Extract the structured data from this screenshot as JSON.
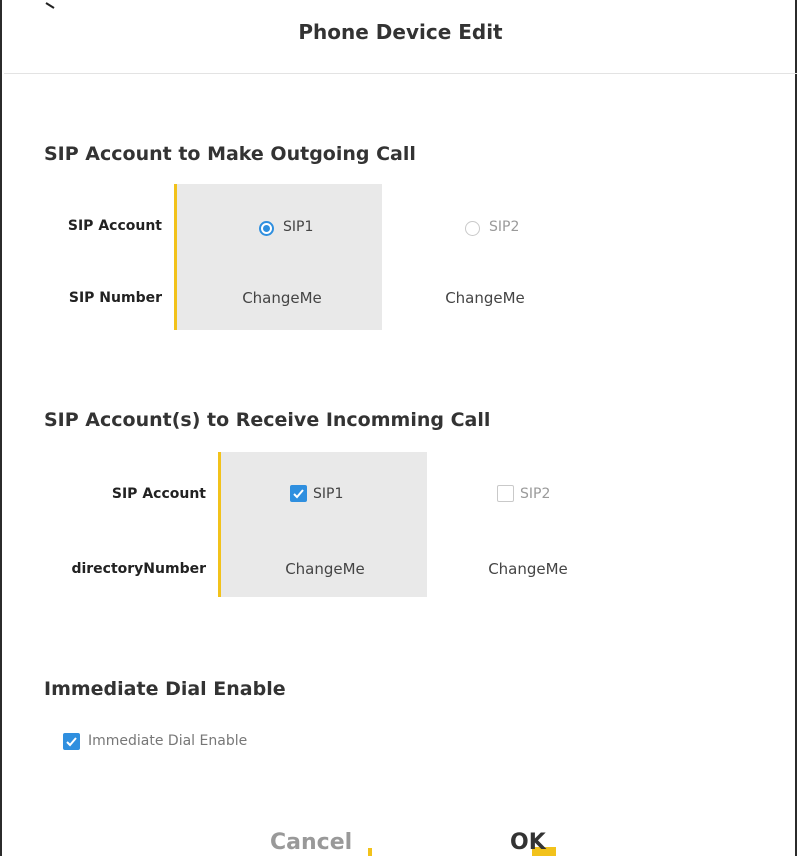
{
  "dialog": {
    "title": "Phone Device Edit"
  },
  "outgoing": {
    "heading": "SIP Account to Make Outgoing Call",
    "account_label": "SIP Account",
    "number_label": "SIP Number",
    "options": [
      {
        "label": "SIP1",
        "selected": true,
        "number": "ChangeMe"
      },
      {
        "label": "SIP2",
        "selected": false,
        "number": "ChangeMe"
      }
    ]
  },
  "incoming": {
    "heading": "SIP Account(s) to Receive Incomming Call",
    "account_label": "SIP Account",
    "number_label": "directoryNumber",
    "options": [
      {
        "label": "SIP1",
        "checked": true,
        "number": "ChangeMe"
      },
      {
        "label": "SIP2",
        "checked": false,
        "number": "ChangeMe"
      }
    ]
  },
  "immediate": {
    "heading": "Immediate Dial Enable",
    "checkbox_label": "Immediate Dial Enable",
    "checked": true
  },
  "footer": {
    "cancel_label": "Cancel",
    "ok_label": "OK"
  },
  "colors": {
    "accent": "#2f8fdf",
    "highlight": "#f2c21b",
    "selected_bg": "#e9e9e9"
  }
}
